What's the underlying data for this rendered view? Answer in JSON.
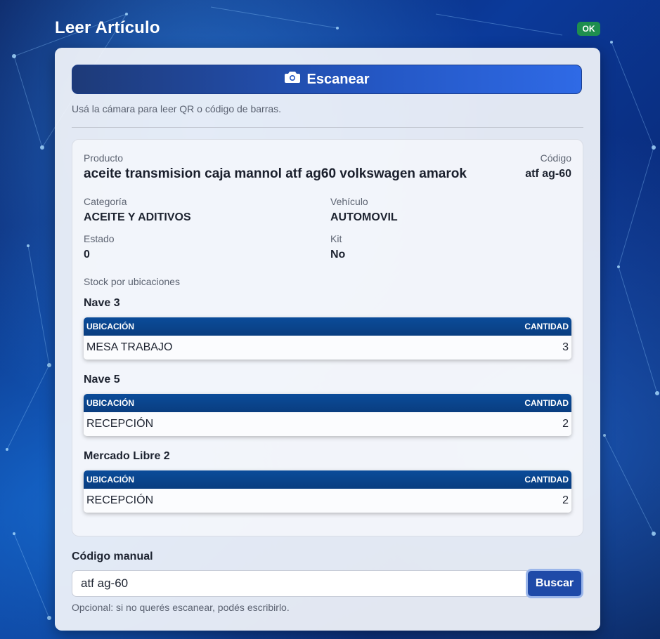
{
  "header": {
    "title": "Leer Artículo",
    "status_badge": "OK"
  },
  "scanner": {
    "button_label": "Escanear",
    "button_icon": "camera-icon",
    "help_text": "Usá la cámara para leer QR o código de barras."
  },
  "product": {
    "name_label": "Producto",
    "name": "aceite transmision caja mannol atf ag60 volkswagen amarok",
    "code_label": "Código",
    "code": "atf ag-60",
    "category_label": "Categoría",
    "category": "ACEITE Y ADITIVOS",
    "vehicle_label": "Vehículo",
    "vehicle": "AUTOMOVIL",
    "status_label": "Estado",
    "status": "0",
    "kit_label": "Kit",
    "kit": "No"
  },
  "stock": {
    "title": "Stock por ubicaciones",
    "columns": [
      "UBICACIÓN",
      "CANTIDAD"
    ],
    "groups": [
      {
        "name": "Nave 3",
        "rows": [
          {
            "location": "MESA TRABAJO",
            "qty": "3"
          }
        ]
      },
      {
        "name": "Nave 5",
        "rows": [
          {
            "location": "RECEPCIÓN",
            "qty": "2"
          }
        ]
      },
      {
        "name": "Mercado Libre 2",
        "rows": [
          {
            "location": "RECEPCIÓN",
            "qty": "2"
          }
        ]
      }
    ]
  },
  "manual": {
    "label": "Código manual",
    "input_value": "atf ag-60",
    "search_label": "Buscar",
    "help_text": "Opcional: si no querés escanear, podés escribirlo."
  },
  "colors": {
    "accent": "#2457c4",
    "table_header": "#0b4c9a",
    "badge_ok": "#1e8e4e"
  }
}
